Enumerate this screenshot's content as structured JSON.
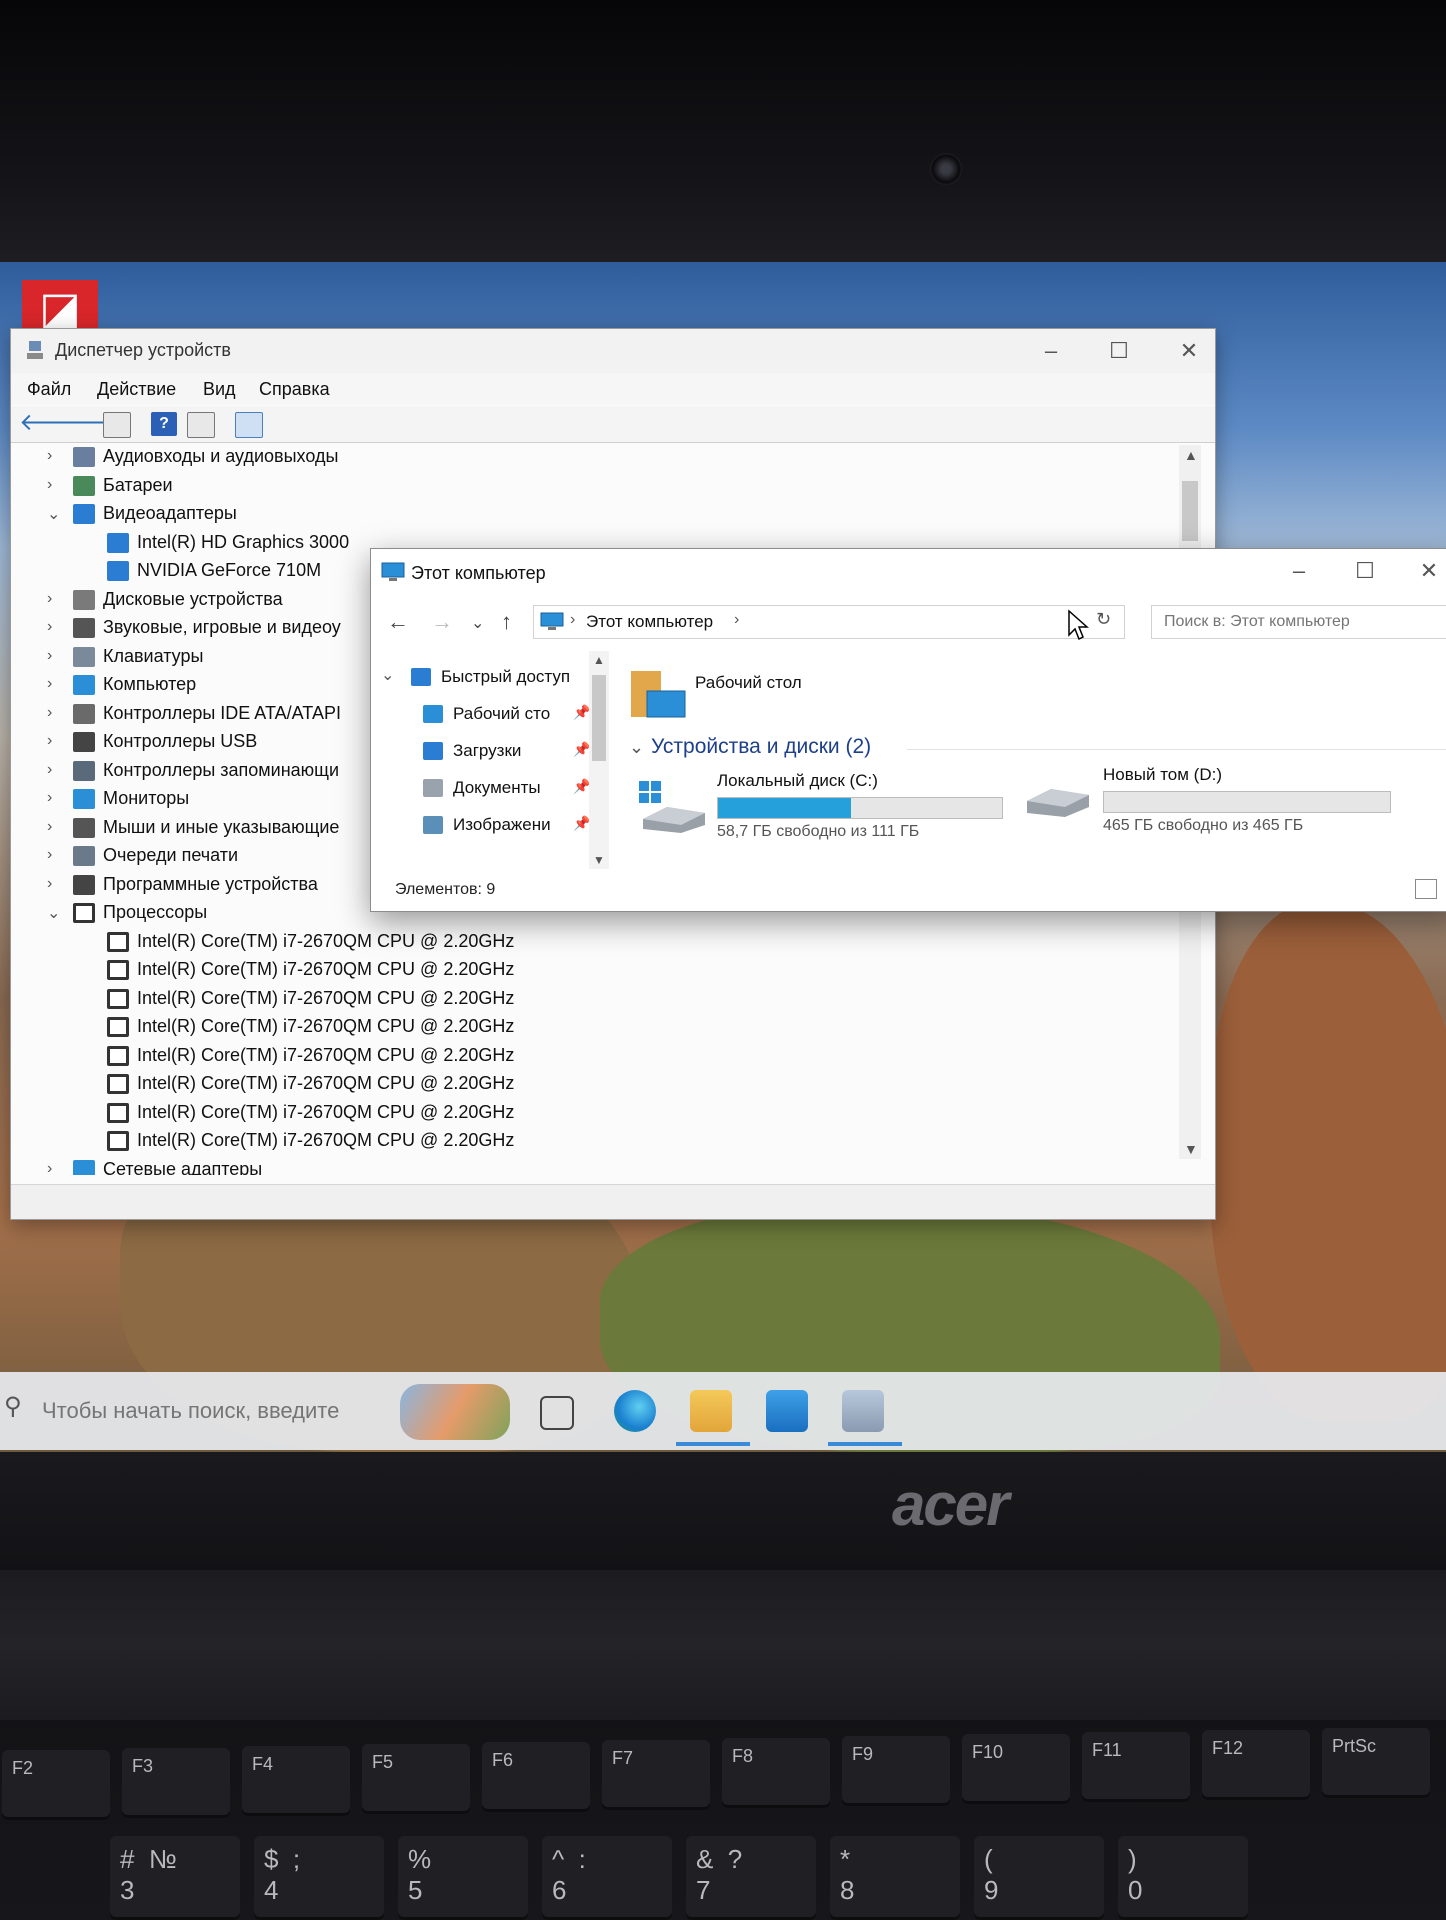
{
  "brand": "acer",
  "device_manager": {
    "title": "Диспетчер устройств",
    "menu": [
      "Файл",
      "Действие",
      "Вид",
      "Справка"
    ],
    "tree": [
      {
        "label": "Аудиовходы и аудиовыходы",
        "chev": "›",
        "indent": 0
      },
      {
        "label": "Батареи",
        "chev": "›",
        "indent": 0
      },
      {
        "label": "Видеоадаптеры",
        "chev": "⌄",
        "indent": 0
      },
      {
        "label": "Intel(R) HD Graphics 3000",
        "chev": "",
        "indent": 1
      },
      {
        "label": "NVIDIA GeForce 710M",
        "chev": "",
        "indent": 1
      },
      {
        "label": "Дисковые устройства",
        "chev": "›",
        "indent": 0
      },
      {
        "label": "Звуковые, игровые и видеоу",
        "chev": "›",
        "indent": 0
      },
      {
        "label": "Клавиатуры",
        "chev": "›",
        "indent": 0
      },
      {
        "label": "Компьютер",
        "chev": "›",
        "indent": 0
      },
      {
        "label": "Контроллеры IDE ATA/ATAPI",
        "chev": "›",
        "indent": 0
      },
      {
        "label": "Контроллеры USB",
        "chev": "›",
        "indent": 0
      },
      {
        "label": "Контроллеры запоминающи",
        "chev": "›",
        "indent": 0
      },
      {
        "label": "Мониторы",
        "chev": "›",
        "indent": 0
      },
      {
        "label": "Мыши и иные указывающие",
        "chev": "›",
        "indent": 0
      },
      {
        "label": "Очереди печати",
        "chev": "›",
        "indent": 0
      },
      {
        "label": "Программные устройства",
        "chev": "›",
        "indent": 0
      },
      {
        "label": "Процессоры",
        "chev": "⌄",
        "indent": 0
      },
      {
        "label": "Intel(R) Core(TM) i7-2670QM CPU @ 2.20GHz",
        "chev": "",
        "indent": 1
      },
      {
        "label": "Intel(R) Core(TM) i7-2670QM CPU @ 2.20GHz",
        "chev": "",
        "indent": 1
      },
      {
        "label": "Intel(R) Core(TM) i7-2670QM CPU @ 2.20GHz",
        "chev": "",
        "indent": 1
      },
      {
        "label": "Intel(R) Core(TM) i7-2670QM CPU @ 2.20GHz",
        "chev": "",
        "indent": 1
      },
      {
        "label": "Intel(R) Core(TM) i7-2670QM CPU @ 2.20GHz",
        "chev": "",
        "indent": 1
      },
      {
        "label": "Intel(R) Core(TM) i7-2670QM CPU @ 2.20GHz",
        "chev": "",
        "indent": 1
      },
      {
        "label": "Intel(R) Core(TM) i7-2670QM CPU @ 2.20GHz",
        "chev": "",
        "indent": 1
      },
      {
        "label": "Intel(R) Core(TM) i7-2670QM CPU @ 2.20GHz",
        "chev": "",
        "indent": 1
      },
      {
        "label": "Сетевые адаптеры",
        "chev": "›",
        "indent": 0
      }
    ]
  },
  "explorer": {
    "title": "Этот компьютер",
    "address": "Этот компьютер",
    "search_placeholder": "Поиск в: Этот компьютер",
    "nav": [
      {
        "label": "Быстрый доступ",
        "pinned": false,
        "color": "#2b7cd3"
      },
      {
        "label": "Рабочий сто",
        "pinned": true,
        "color": "#2b8fd8"
      },
      {
        "label": "Загрузки",
        "pinned": true,
        "color": "#2b7cd3"
      },
      {
        "label": "Документы",
        "pinned": true,
        "color": "#9aa3ad"
      },
      {
        "label": "Изображени",
        "pinned": true,
        "color": "#5a8fb8"
      }
    ],
    "folder": "Рабочий стол",
    "section": "Устройства и диски (2)",
    "drives": [
      {
        "name": "Локальный диск (C:)",
        "free_text": "58,7 ГБ свободно из 111 ГБ",
        "used_fraction": 0.47
      },
      {
        "name": "Новый том (D:)",
        "free_text": "465 ГБ свободно из 465 ГБ",
        "used_fraction": 0.0
      }
    ],
    "status": "Элементов: 9"
  },
  "taskbar": {
    "search_placeholder": "Чтобы начать поиск, введите"
  },
  "keys": {
    "fn_row": [
      "F2",
      "F3",
      "F4",
      "F5",
      "F6",
      "F7",
      "F8",
      "F9",
      "F10",
      "F11",
      "F12",
      "PrtSc"
    ],
    "num_row": [
      "#  №\n3",
      "$  ;\n4",
      "%\n5",
      "^  :\n6",
      "&  ?\n7",
      "*\n8",
      "(\n9",
      ")\n0"
    ]
  },
  "colors": {
    "accent": "#26a0da",
    "brand_red": "#d8262a"
  }
}
